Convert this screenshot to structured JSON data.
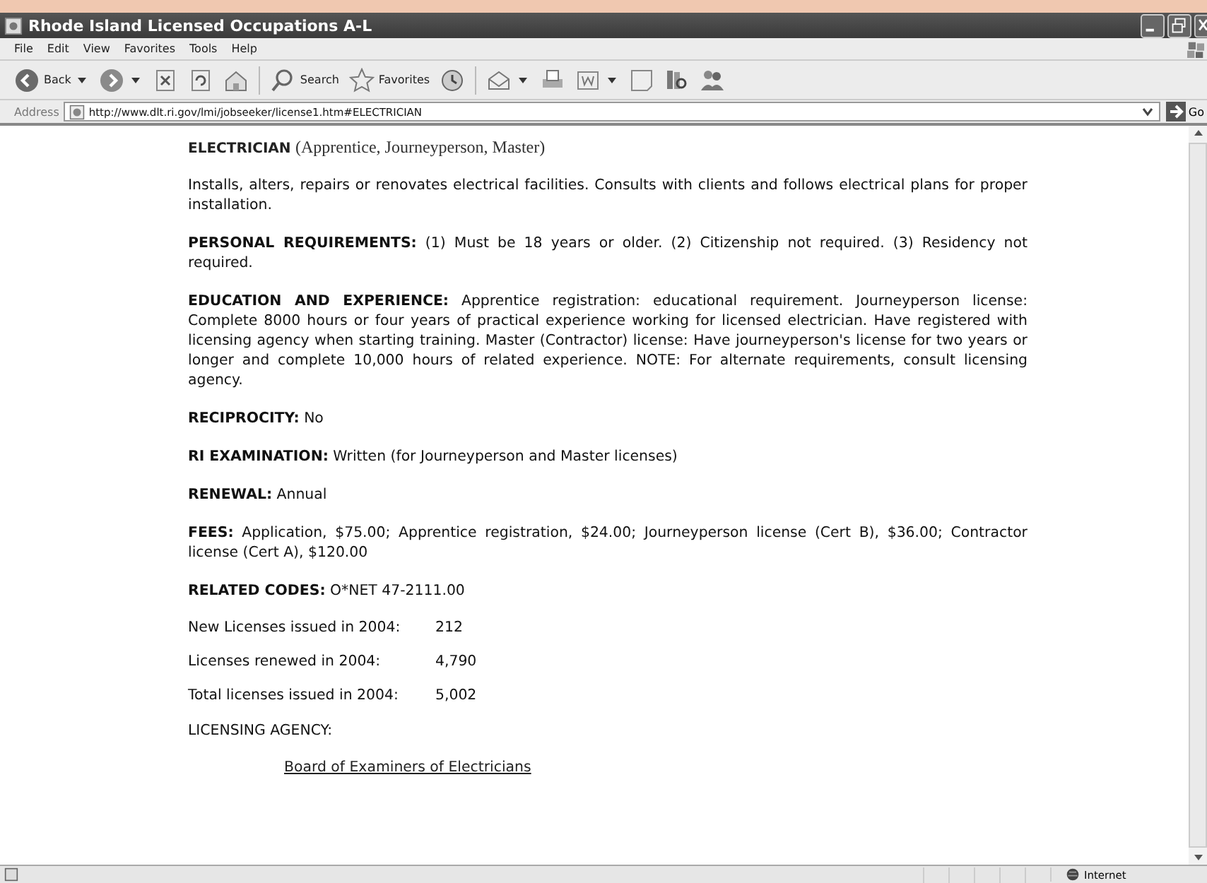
{
  "window": {
    "title": "Rhode Island Licensed Occupations A-L"
  },
  "menu": [
    "File",
    "Edit",
    "View",
    "Favorites",
    "Tools",
    "Help"
  ],
  "toolbar": [
    {
      "kind": "back",
      "label": "Back",
      "dropdown": true
    },
    {
      "kind": "forward",
      "dropdown": true
    },
    {
      "kind": "stop"
    },
    {
      "kind": "refresh"
    },
    {
      "kind": "home"
    },
    {
      "kind": "search",
      "label": "Search"
    },
    {
      "kind": "favorites",
      "label": "Favorites"
    },
    {
      "kind": "history"
    },
    {
      "kind": "mail",
      "dropdown": true
    },
    {
      "kind": "print"
    },
    {
      "kind": "word",
      "dropdown": true
    },
    {
      "kind": "note"
    },
    {
      "kind": "research"
    },
    {
      "kind": "messenger"
    }
  ],
  "address": {
    "label": "Address",
    "url": "http://www.dlt.ri.gov/lmi/jobseeker/license1.htm#ELECTRICIAN",
    "go": "Go"
  },
  "content": [
    {
      "kind": "heading",
      "title": "ELECTRICIAN",
      "subtitle": "(Apprentice, Journeyperson, Master)"
    },
    {
      "kind": "para",
      "text": "Installs, alters, repairs or renovates electrical facilities. Consults with clients and follows electrical plans for proper installation."
    },
    {
      "kind": "para",
      "text": "**PERSONAL REQUIREMENTS:** (1) Must be 18 years or older. (2) Citizenship not required. (3) Residency not required."
    },
    {
      "kind": "para",
      "text": "**EDUCATION AND EXPERIENCE:** Apprentice registration: educational requirement. Journeyperson license: Complete 8000 hours or four years of practical experience working for licensed electrician. Have registered with licensing agency when starting training. Master (Contractor) license: Have journeyperson's license for two years or longer and complete 10,000 hours of related experience. NOTE: For alternate requirements, consult licensing agency."
    },
    {
      "kind": "para",
      "text": "**RECIPROCITY:** No"
    },
    {
      "kind": "para",
      "text": "**RI EXAMINATION:** Written (for Journeyperson and Master licenses)"
    },
    {
      "kind": "para",
      "text": "**RENEWAL:** Annual"
    },
    {
      "kind": "para",
      "text": "**FEES:** Application, $75.00; Apprentice registration, $24.00; Journeyperson license (Cert B), $36.00; Contractor license (Cert A), $120.00"
    },
    {
      "kind": "para",
      "text": "**RELATED CODES:** O*NET 47-2111.00"
    },
    {
      "kind": "stat",
      "label": "New Licenses issued in 2004:",
      "value": "212"
    },
    {
      "kind": "stat",
      "label": "Licenses renewed in 2004:",
      "value": "4,790"
    },
    {
      "kind": "stat",
      "label": "Total licenses issued in 2004:",
      "value": "5,002"
    },
    {
      "kind": "para",
      "text": "LICENSING AGENCY:"
    },
    {
      "kind": "link",
      "text": "Board of Examiners of Electricians"
    }
  ],
  "status_bar": {
    "zone": "Internet"
  }
}
